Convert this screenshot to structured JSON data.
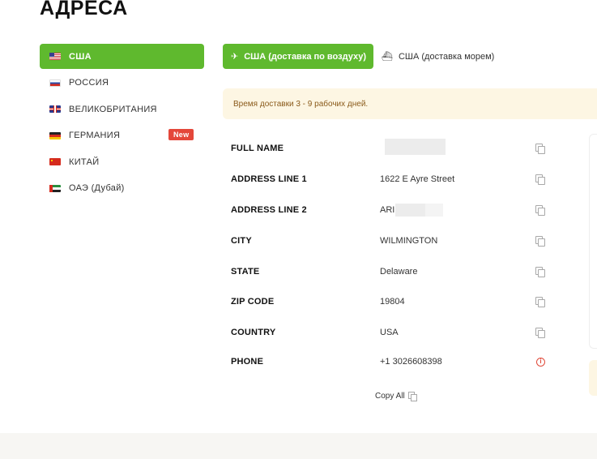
{
  "page": {
    "title": "АДРЕСА"
  },
  "sidebar": {
    "items": [
      {
        "label": "США",
        "flag": "us",
        "active": true
      },
      {
        "label": "РОССИЯ",
        "flag": "ru",
        "active": false
      },
      {
        "label": "ВЕЛИКОБРИТАНИЯ",
        "flag": "gb",
        "active": false
      },
      {
        "label": "ГЕРМАНИЯ",
        "flag": "de",
        "active": false,
        "badge": "New"
      },
      {
        "label": "КИТАЙ",
        "flag": "cn",
        "active": false
      },
      {
        "label": "ОАЭ (Дубай)",
        "flag": "ae",
        "active": false
      }
    ]
  },
  "tabs": {
    "air": {
      "label": "США (доставка по воздуху)",
      "icon": "airplane-icon",
      "active": true
    },
    "sea": {
      "label": "США (доставка морем)",
      "icon": "ship-icon",
      "active": false
    }
  },
  "notice": {
    "text": "Время доставки 3 - 9 рабочих дней."
  },
  "address": {
    "rows": [
      {
        "label": "FULL NAME",
        "value": ""
      },
      {
        "label": "ADDRESS LINE 1",
        "value": "1622 E Ayre Street"
      },
      {
        "label": "ADDRESS LINE 2",
        "value": "ARI"
      },
      {
        "label": "CITY",
        "value": "WILMINGTON"
      },
      {
        "label": "STATE",
        "value": "Delaware"
      },
      {
        "label": "ZIP CODE",
        "value": "19804"
      },
      {
        "label": "COUNTRY",
        "value": "USA"
      },
      {
        "label": "PHONE",
        "value": "+1 3026608398"
      }
    ],
    "copy_all": "Copy All"
  },
  "colors": {
    "accent": "#5fb92e",
    "badge": "#e4473a",
    "notice_bg": "#fdf6e3",
    "notice_text": "#8a5a1a"
  }
}
